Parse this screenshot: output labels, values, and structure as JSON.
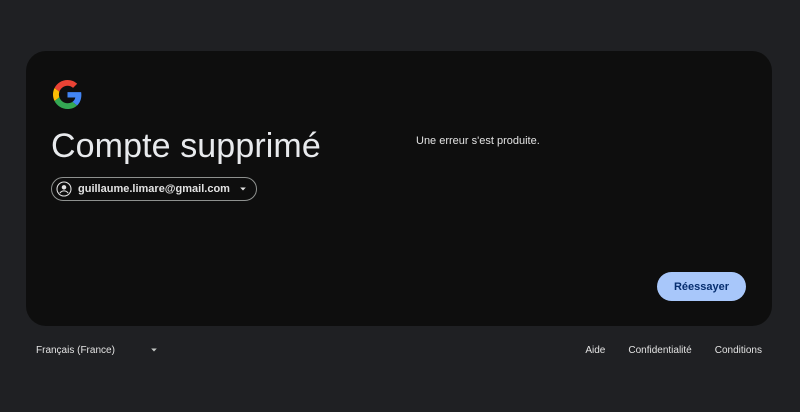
{
  "card": {
    "logo_icon": "google-g-logo",
    "title": "Compte supprimé",
    "account": {
      "email": "guillaume.limare@gmail.com",
      "avatar_icon": "account-circle-icon",
      "caret_icon": "caret-down-icon"
    },
    "error_message": "Une erreur s'est produite.",
    "retry_label": "Réessayer"
  },
  "footer": {
    "language": "Français (France)",
    "language_caret_icon": "caret-down-icon",
    "links": [
      "Aide",
      "Confidentialité",
      "Conditions"
    ]
  },
  "colors": {
    "page_background": "#1f2023",
    "card_background": "#0e0e0e",
    "accent_button": "#a8c7fa",
    "accent_button_text": "#062e6f"
  }
}
